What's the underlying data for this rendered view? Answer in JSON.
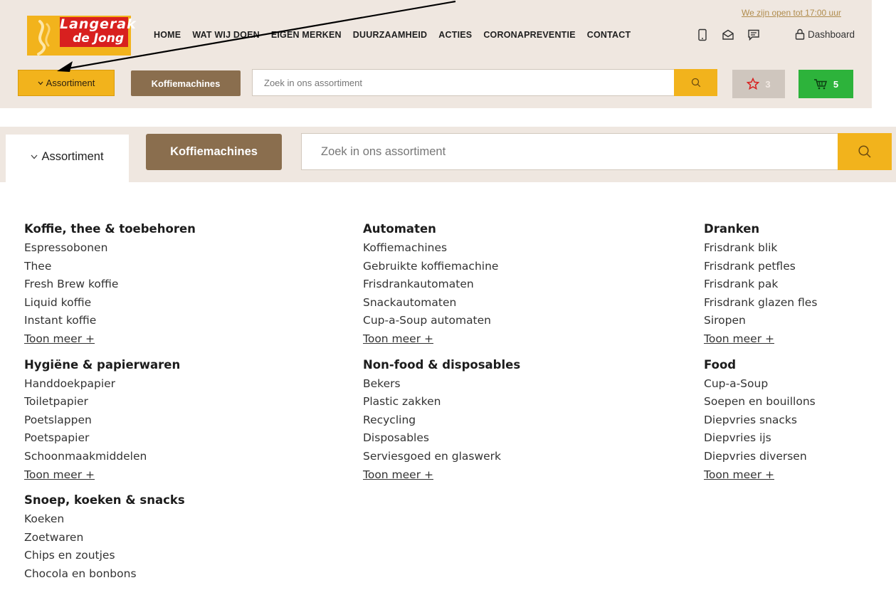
{
  "header": {
    "logo_line1": "Langerak",
    "logo_line2": "de Jong",
    "open_hours": "We zijn open tot 17:00 uur",
    "nav": [
      "HOME",
      "WAT WIJ DOEN",
      "EIGEN MERKEN",
      "DUURZAAMHEID",
      "ACTIES",
      "CORONAPREVENTIE",
      "CONTACT"
    ],
    "dashboard_label": "Dashboard",
    "utility_icons": [
      "phone-icon",
      "envelope-icon",
      "chat-icon",
      "lock-icon"
    ]
  },
  "toolbar": {
    "assortiment_label": "Assortiment",
    "koffiemachines_label": "Koffiemachines",
    "search_placeholder": "Zoek in ons assortiment",
    "favorites_count": "3",
    "cart_count": "5"
  },
  "colors": {
    "accent_yellow": "#f2b31c",
    "brown": "#8a6e4e",
    "green": "#2db33b",
    "red": "#d8201f",
    "beige": "#efe7e0"
  },
  "menu": {
    "columns": [
      {
        "categories": [
          {
            "title": "Koffie, thee & toebehoren",
            "items": [
              "Espressobonen",
              "Thee",
              "Fresh Brew koffie",
              "Liquid koffie",
              "Instant koffie"
            ],
            "more": "Toon meer +"
          },
          {
            "title": "Hygiëne & papierwaren",
            "items": [
              "Handdoekpapier",
              "Toiletpapier",
              "Poetslappen",
              "Poetspapier",
              "Schoonmaakmiddelen"
            ],
            "more": "Toon meer +"
          },
          {
            "title": "Snoep, koeken & snacks",
            "items": [
              "Koeken",
              "Zoetwaren",
              "Chips en zoutjes",
              "Chocola en bonbons"
            ]
          }
        ]
      },
      {
        "categories": [
          {
            "title": "Automaten",
            "items": [
              "Koffiemachines",
              "Gebruikte koffiemachine",
              "Frisdrankautomaten",
              "Snackautomaten",
              "Cup-a-Soup automaten"
            ],
            "more": "Toon meer +"
          },
          {
            "title": "Non-food & disposables",
            "items": [
              "Bekers",
              "Plastic zakken",
              "Recycling",
              "Disposables",
              "Serviesgoed en glaswerk"
            ],
            "more": "Toon meer +"
          }
        ]
      },
      {
        "categories": [
          {
            "title": "Dranken",
            "items": [
              "Frisdrank blik",
              "Frisdrank petfles",
              "Frisdrank pak",
              "Frisdrank glazen fles",
              "Siropen"
            ],
            "more": "Toon meer +"
          },
          {
            "title": "Food",
            "items": [
              "Cup-a-Soup",
              "Soepen en bouillons",
              "Diepvries snacks",
              "Diepvries ijs",
              "Diepvries diversen"
            ],
            "more": "Toon meer +"
          }
        ]
      }
    ]
  }
}
